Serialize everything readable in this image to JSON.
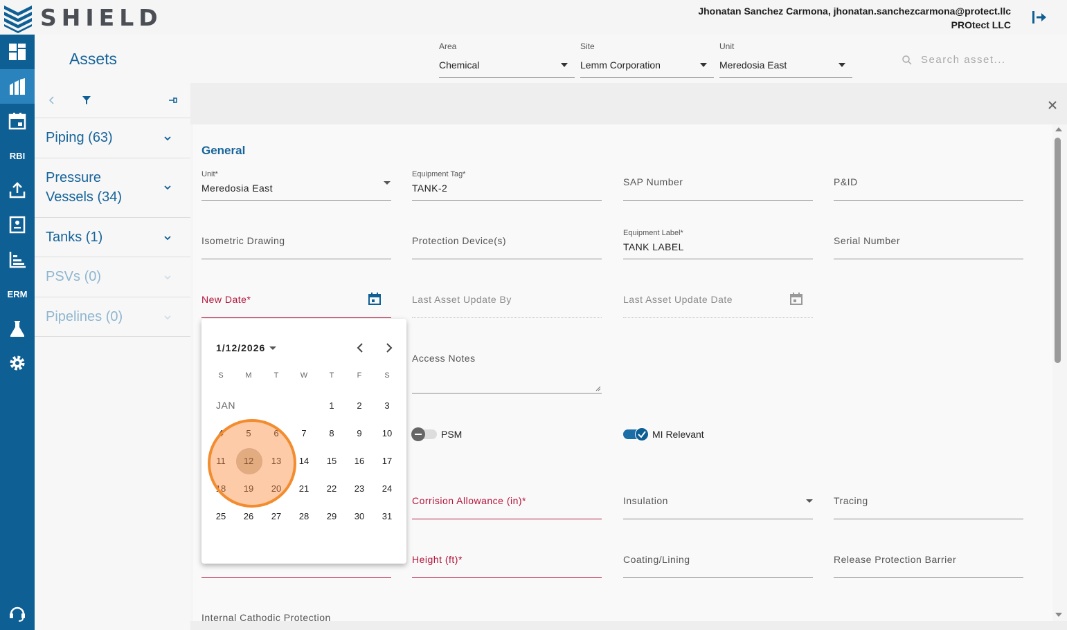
{
  "app": {
    "brand": "SHIELD",
    "user_line": "Jhonatan Sanchez Carmona, jhonatan.sanchezcarmona@protect.llc",
    "org_line": "PROtect LLC"
  },
  "rail": {
    "rbi_label": "RBI",
    "erm_label": "ERM"
  },
  "header": {
    "title": "Assets",
    "area": {
      "label": "Area",
      "value": "Chemical"
    },
    "site": {
      "label": "Site",
      "value": "Lemm Corporation"
    },
    "unit": {
      "label": "Unit",
      "value": "Meredosia East"
    },
    "search_placeholder": "Search asset..."
  },
  "categories": [
    {
      "label": "Piping (63)",
      "enabled": true
    },
    {
      "label": "Pressure Vessels (34)",
      "enabled": true
    },
    {
      "label": "Tanks (1)",
      "enabled": true
    },
    {
      "label": "PSVs (0)",
      "enabled": false
    },
    {
      "label": "Pipelines (0)",
      "enabled": false
    }
  ],
  "form": {
    "section_title": "General",
    "unit": {
      "label": "Unit*",
      "value": "Meredosia East"
    },
    "equipment_tag": {
      "label": "Equipment Tag*",
      "value": "TANK-2"
    },
    "sap_number": "SAP Number",
    "pid": "P&ID",
    "isometric_drawing": "Isometric Drawing",
    "protection_devices": "Protection Device(s)",
    "equipment_label": {
      "label": "Equipment Label*",
      "value": "TANK LABEL"
    },
    "serial_number": "Serial Number",
    "new_date": "New Date*",
    "last_update_by": "Last Asset Update By",
    "last_update_date": "Last Asset Update Date",
    "access_notes": "Access Notes",
    "psm": {
      "label": "PSM",
      "on": false
    },
    "mi_relevant": {
      "label": "MI Relevant",
      "on": true
    },
    "corrosion_allowance": "Corrision Allowance (in)*",
    "insulation": "Insulation",
    "tracing": "Tracing",
    "height": "Height (ft)*",
    "coating": "Coating/Lining",
    "release_barrier": "Release Protection Barrier",
    "internal_cathodic": "Internal Cathodic Protection"
  },
  "datepicker": {
    "current": "1/12/2026",
    "month_label": "JAN",
    "weekdays": [
      "S",
      "M",
      "T",
      "W",
      "T",
      "F",
      "S"
    ],
    "days": [
      "1",
      "2",
      "3",
      "4",
      "5",
      "6",
      "7",
      "8",
      "9",
      "10",
      "11",
      "12",
      "13",
      "14",
      "15",
      "16",
      "17",
      "18",
      "19",
      "20",
      "21",
      "22",
      "23",
      "24",
      "25",
      "26",
      "27",
      "28",
      "29",
      "30",
      "31"
    ],
    "first_weekday_index": 4,
    "selected": "12"
  },
  "colors": {
    "brand_blue": "#0e5f94",
    "accent": "#17649a",
    "error": "#b3143b",
    "highlight": "#f28c2e"
  }
}
